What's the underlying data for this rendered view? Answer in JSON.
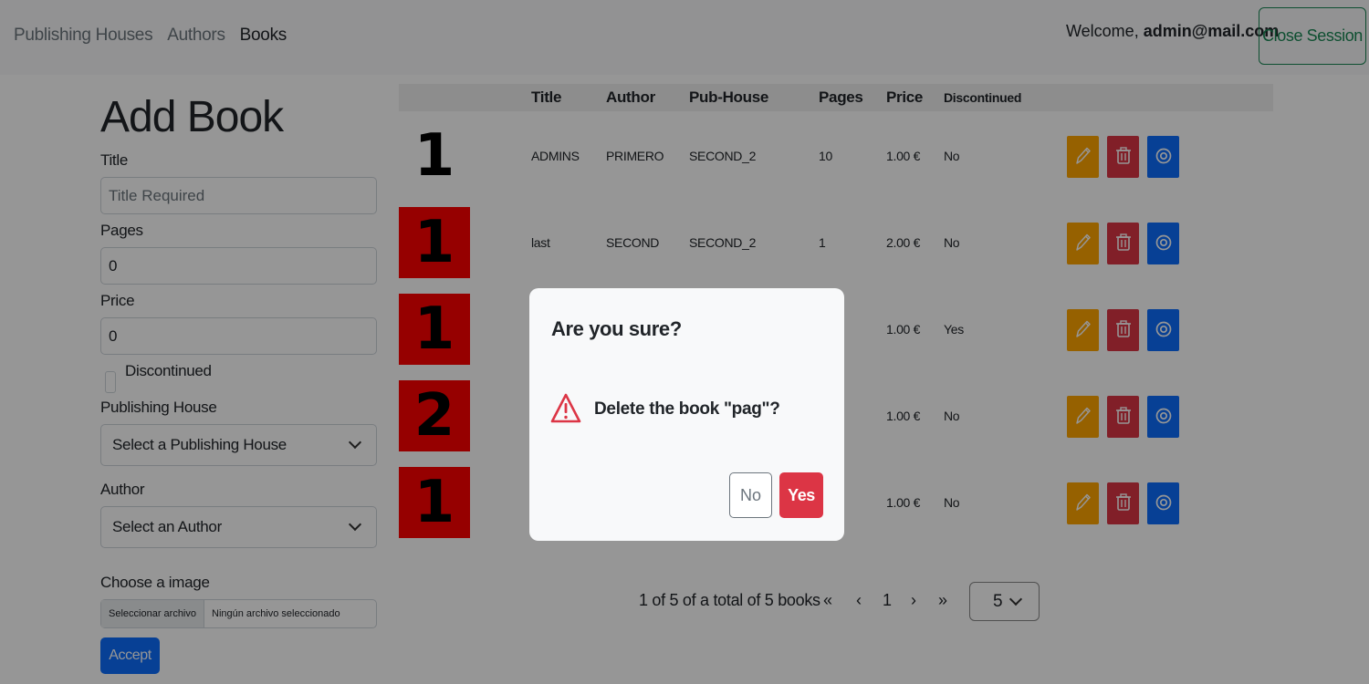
{
  "nav": {
    "links": [
      "Publishing Houses",
      "Authors",
      "Books"
    ],
    "welcome_prefix": "Welcome,",
    "user_email": "admin@mail.com",
    "close_session": "Close Session"
  },
  "form": {
    "title": "Add Book",
    "title_label": "Title",
    "title_placeholder": "Title Required",
    "pages_label": "Pages",
    "pages_value": "0",
    "price_label": "Price",
    "price_value": "0",
    "discontinued_label": "Discontinued",
    "pubhouse_label": "Publishing House",
    "pubhouse_selected": "Select a Publishing House",
    "author_label": "Author",
    "author_selected": "Select an Author",
    "image_label": "Choose a image",
    "file_button": "Seleccionar archivo",
    "file_none": "Ningún archivo seleccionado",
    "accept": "Accept"
  },
  "table": {
    "headers": [
      "Title",
      "Author",
      "Pub-House",
      "Pages",
      "Price",
      "Discontinued"
    ],
    "rows": [
      {
        "image_text": "1",
        "title": "ADMINS",
        "author": "PRIMERO",
        "pubhouse": "SECOND_2",
        "pages": "10",
        "price": "1.00 €",
        "discontinued": "No",
        "red": false
      },
      {
        "image_text": "1",
        "title": "last",
        "author": "SECOND",
        "pubhouse": "SECOND_2",
        "pages": "1",
        "price": "2.00 €",
        "discontinued": "No",
        "red": true
      },
      {
        "image_text": "1",
        "title": "",
        "author": "",
        "pubhouse": "",
        "pages": "",
        "price": "1.00 €",
        "discontinued": "Yes",
        "red": true
      },
      {
        "image_text": "2",
        "title": "",
        "author": "",
        "pubhouse": "",
        "pages": "",
        "price": "1.00 €",
        "discontinued": "No",
        "red": true
      },
      {
        "image_text": "1",
        "title": "",
        "author": "",
        "pubhouse": "",
        "pages": "",
        "price": "1.00 €",
        "discontinued": "No",
        "red": true
      }
    ]
  },
  "pagination": {
    "summary": "1 of 5 of a total of 5 books",
    "first": "«",
    "prev": "‹",
    "current": "1",
    "next": "›",
    "last": "»",
    "page_size": "5"
  },
  "modal": {
    "title": "Are you sure?",
    "message": "Delete the book \"pag\"?",
    "no": "No",
    "yes": "Yes"
  },
  "colors": {
    "edit": "#ffa500",
    "delete": "#dc3545",
    "view": "#0d6efd",
    "image_red": "#ff0000"
  }
}
